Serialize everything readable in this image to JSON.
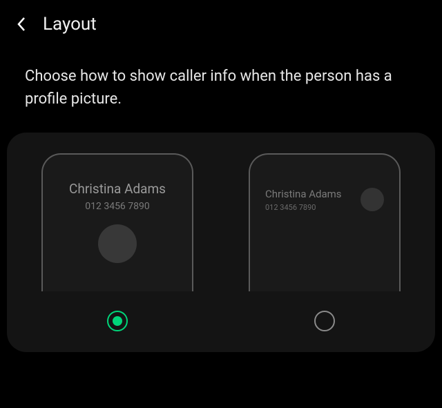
{
  "header": {
    "title": "Layout"
  },
  "description": "Choose how to show caller info when the person has a profile picture.",
  "options": {
    "centered": {
      "caller_name": "Christina Adams",
      "caller_number": "012 3456 7890",
      "selected": true
    },
    "topleft": {
      "caller_name": "Christina Adams",
      "caller_number": "012 3456 7890",
      "selected": false
    }
  },
  "colors": {
    "accent": "#00d67a",
    "background": "#000000",
    "panel": "#141414"
  }
}
